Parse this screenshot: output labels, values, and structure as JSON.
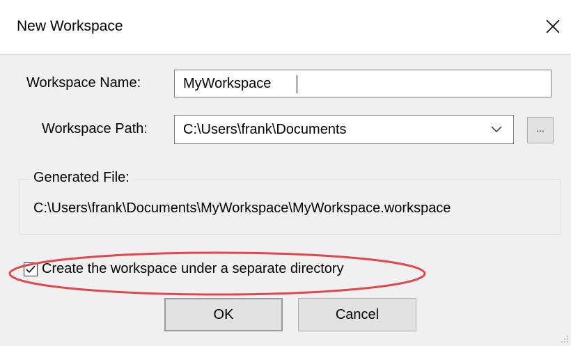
{
  "window": {
    "title": "New Workspace",
    "close_icon": "close-icon"
  },
  "form": {
    "name_label": "Workspace Name:",
    "name_value": "MyWorkspace",
    "path_label": "Workspace Path:",
    "path_value": "C:\\Users\\frank\\Documents",
    "browse_label": "...",
    "generated_label": "Generated File:",
    "generated_value": "C:\\Users\\frank\\Documents\\MyWorkspace\\MyWorkspace.workspace",
    "separate_dir_label": "Create the workspace under a separate directory",
    "separate_dir_checked": true
  },
  "buttons": {
    "ok": "OK",
    "cancel": "Cancel"
  },
  "colors": {
    "highlight": "#e0474c",
    "background": "#f0f0f0"
  }
}
